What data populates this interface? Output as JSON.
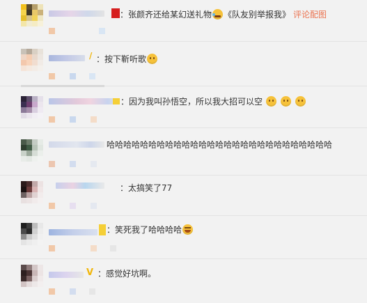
{
  "comments": [
    {
      "text": "张颜齐还给某幻送礼物",
      "emoji": "tear-laugh-icon",
      "song": "《队友别举报我》",
      "link": "评论配图"
    },
    {
      "text": "按下靳听歌",
      "emoji": "cat-face-icon"
    },
    {
      "text": "因为我叫孙悟空，所以我大招可以空",
      "emojis": [
        "cat-face-icon",
        "cat-face-icon",
        "cat-face-icon"
      ]
    },
    {
      "text": "哈哈哈哈哈哈哈哈哈哈哈哈哈哈哈哈哈哈哈哈哈哈哈哈哈哈哈"
    },
    {
      "text": "太搞笑了77"
    },
    {
      "text": "笑死我了哈哈哈哈",
      "emoji": "grin-laugh-icon"
    },
    {
      "text": "感觉好坑啊。",
      "badge": "V"
    }
  ],
  "colon": "：",
  "colors": {
    "link": "#eb7350",
    "background": "#f2f2f2",
    "emoji": "#f6c23b",
    "vip": "#f1b60b"
  }
}
